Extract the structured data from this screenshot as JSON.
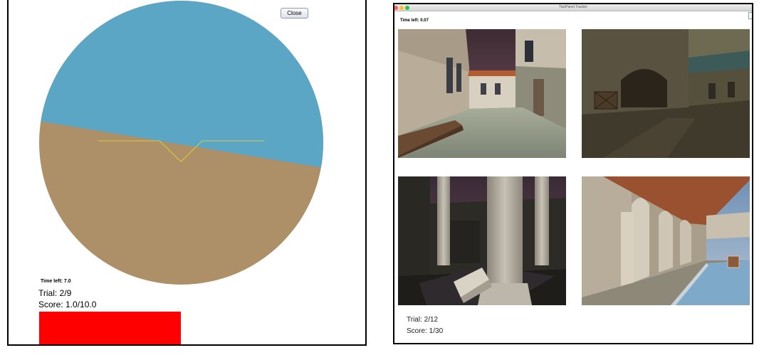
{
  "left_panel": {
    "close_label": "Close",
    "time_left": "Time left: 7.0",
    "trial": "Trial: 2/9",
    "score": "Score: 1.0/10.0",
    "colors": {
      "sky": "#5aa6c4",
      "ground": "#ad8f68",
      "reticle": "#d8cc3c",
      "score_bar": "#ff0000"
    }
  },
  "right_panel": {
    "window_title": "TwoPanel Tracker",
    "time_left": "Time left: 0.07",
    "trial": "Trial: 2/12",
    "score": "Score: 1/30",
    "scenes": [
      {
        "name": "courtyard-street-scene"
      },
      {
        "name": "stone-archway-scene"
      },
      {
        "name": "colonnade-pillars-scene"
      },
      {
        "name": "arcade-pool-scene"
      }
    ]
  }
}
